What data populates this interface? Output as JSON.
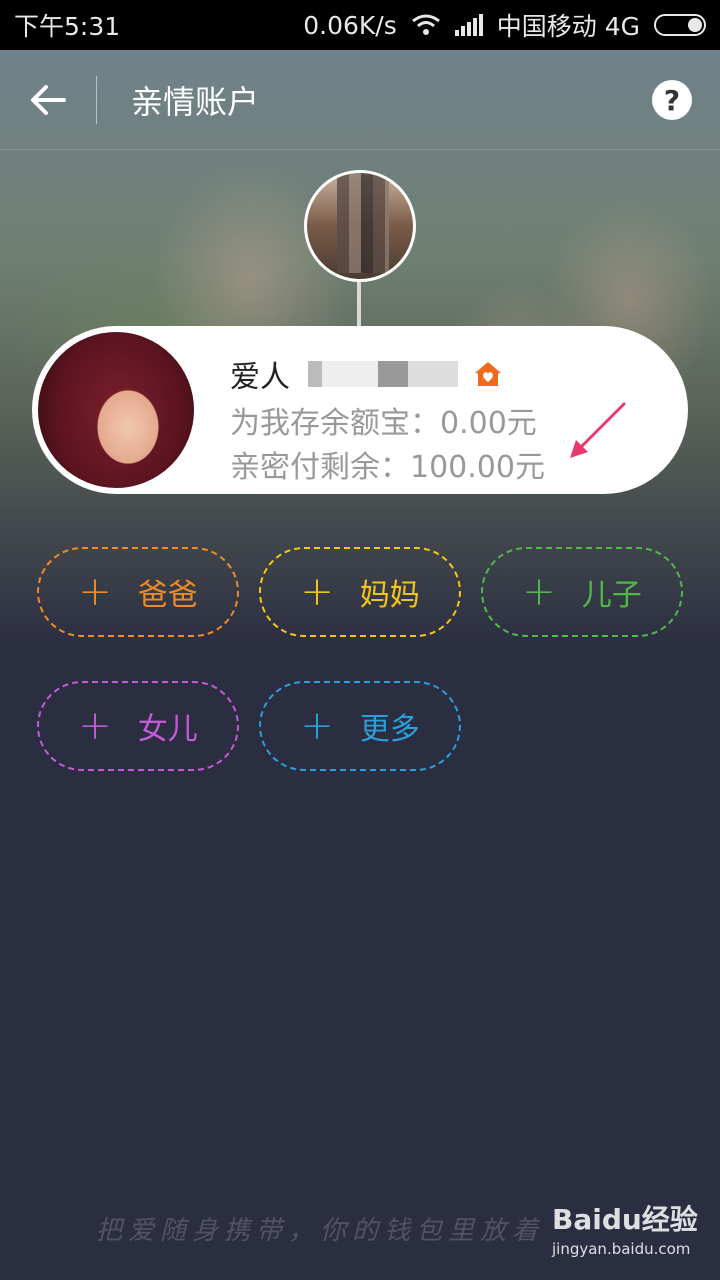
{
  "status_bar": {
    "time": "下午5:31",
    "network_speed": "0.06K/s",
    "carrier": "中国移动 4G"
  },
  "nav": {
    "title": "亲情账户",
    "help_label": "?"
  },
  "member": {
    "name": "爱人",
    "line_saved": "为我存余额宝：0.00元",
    "line_remaining": "亲密付剩余：100.00元"
  },
  "add_buttons": [
    {
      "label": "爸爸",
      "color": "#f08a24"
    },
    {
      "label": "妈妈",
      "color": "#f5c518"
    },
    {
      "label": "儿子",
      "color": "#4fb948"
    },
    {
      "label": "女儿",
      "color": "#c45ad6"
    },
    {
      "label": "更多",
      "color": "#2a9fd9"
    }
  ],
  "plus_symbol": "+",
  "footer": {
    "slogan": "把爱随身携带，你的钱包里放着",
    "watermark_brand": "Baidu经验",
    "watermark_url": "jingyan.baidu.com"
  },
  "colors": {
    "background": "#2b2d41",
    "accent_house": "#f06a1e",
    "arrow": "#e8386e"
  }
}
